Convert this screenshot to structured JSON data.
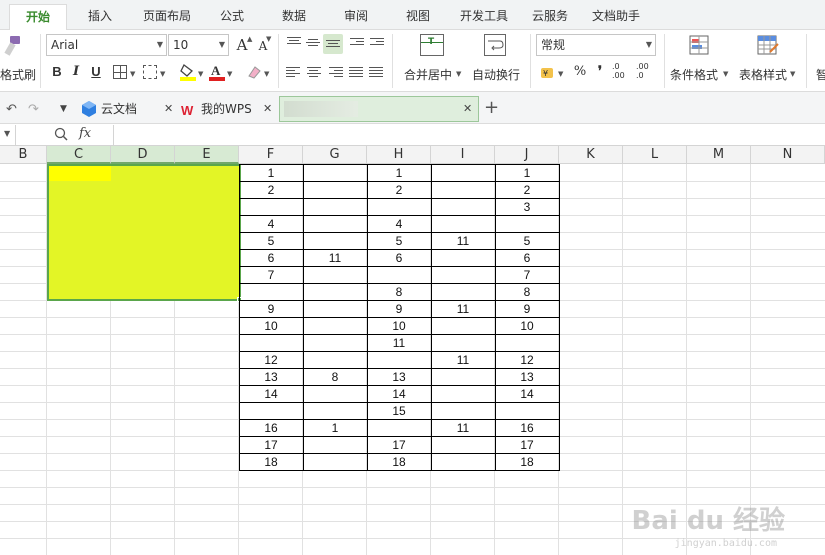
{
  "menu": {
    "tabs": [
      {
        "label": "开始",
        "active": true
      },
      {
        "label": "插入"
      },
      {
        "label": "页面布局"
      },
      {
        "label": "公式"
      },
      {
        "label": "数据"
      },
      {
        "label": "审阅"
      },
      {
        "label": "视图"
      },
      {
        "label": "开发工具"
      },
      {
        "label": "云服务"
      },
      {
        "label": "文档助手"
      }
    ]
  },
  "ribbon": {
    "format_painter_label": "格式刷",
    "font_name": "Arial",
    "font_size": "10",
    "grow_font": "A",
    "shrink_font": "A",
    "bold": "B",
    "italic": "I",
    "underline": "U",
    "merge_label": "合并居中",
    "wrap_label": "自动换行",
    "number_format": "常规",
    "percent": "%",
    "comma": "❜",
    "inc_decimal_label": ".0 .00",
    "dec_decimal_label": ".00 .0",
    "cond_format_label": "条件格式",
    "table_style_label": "表格样式",
    "cut_off_label": "智"
  },
  "doc_tabs": [
    {
      "label": "云文档"
    },
    {
      "label": "我的WPS"
    }
  ],
  "formula_bar": {
    "fx_label": "fx",
    "value": ""
  },
  "columns": [
    "B",
    "C",
    "D",
    "E",
    "F",
    "G",
    "H",
    "I",
    "J",
    "K",
    "L",
    "M",
    "N"
  ],
  "table": {
    "rows": [
      {
        "F": "1",
        "G": "",
        "H": "1",
        "I": "",
        "J": "1"
      },
      {
        "F": "2",
        "G": "",
        "H": "2",
        "I": "",
        "J": "2"
      },
      {
        "F": "",
        "G": "",
        "H": "",
        "I": "",
        "J": "3"
      },
      {
        "F": "4",
        "G": "",
        "H": "4",
        "I": "",
        "J": ""
      },
      {
        "F": "5",
        "G": "",
        "H": "5",
        "I": "11",
        "J": "5"
      },
      {
        "F": "6",
        "G": "11",
        "H": "6",
        "I": "",
        "J": "6"
      },
      {
        "F": "7",
        "G": "",
        "H": "",
        "I": "",
        "J": "7"
      },
      {
        "F": "",
        "G": "",
        "H": "8",
        "I": "",
        "J": "8"
      },
      {
        "F": "9",
        "G": "",
        "H": "9",
        "I": "11",
        "J": "9"
      },
      {
        "F": "10",
        "G": "",
        "H": "10",
        "I": "",
        "J": "10"
      },
      {
        "F": "",
        "G": "",
        "H": "11",
        "I": "",
        "J": ""
      },
      {
        "F": "12",
        "G": "",
        "H": "",
        "I": "11",
        "J": "12"
      },
      {
        "F": "13",
        "G": "8",
        "H": "13",
        "I": "",
        "J": "13"
      },
      {
        "F": "14",
        "G": "",
        "H": "14",
        "I": "",
        "J": "14"
      },
      {
        "F": "",
        "G": "",
        "H": "15",
        "I": "",
        "J": ""
      },
      {
        "F": "16",
        "G": "1",
        "H": "",
        "I": "11",
        "J": "16"
      },
      {
        "F": "17",
        "G": "",
        "H": "17",
        "I": "",
        "J": "17"
      },
      {
        "F": "18",
        "G": "",
        "H": "18",
        "I": "",
        "J": "18"
      }
    ]
  },
  "selection": {
    "fill_color": "#e3f526",
    "border_color": "#5aa64b"
  },
  "watermark": {
    "main": "Bai du 经验",
    "sub": "jingyan.baidu.com"
  }
}
